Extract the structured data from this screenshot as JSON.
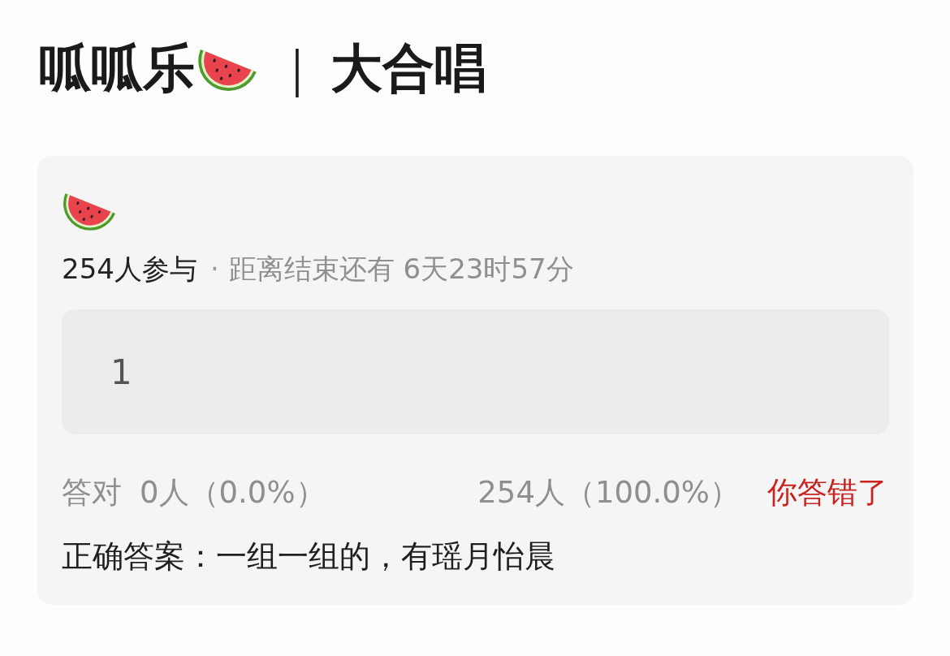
{
  "header": {
    "title": "呱呱乐",
    "separator": "｜",
    "subtitle": "大合唱"
  },
  "quiz_card": {
    "participants": "254人参与",
    "separator": "·",
    "time_remaining": "距离结束还有 6天23时57分",
    "answer": "1",
    "stats": {
      "correct_label": "答对",
      "correct_count": "0人（0.0%）",
      "wrong_count": "254人（100.0%）",
      "result": {
        "text": "你答错了",
        "correct": false
      }
    },
    "correct_answer": "正确答案：一组一组的，有瑶月怡晨"
  }
}
